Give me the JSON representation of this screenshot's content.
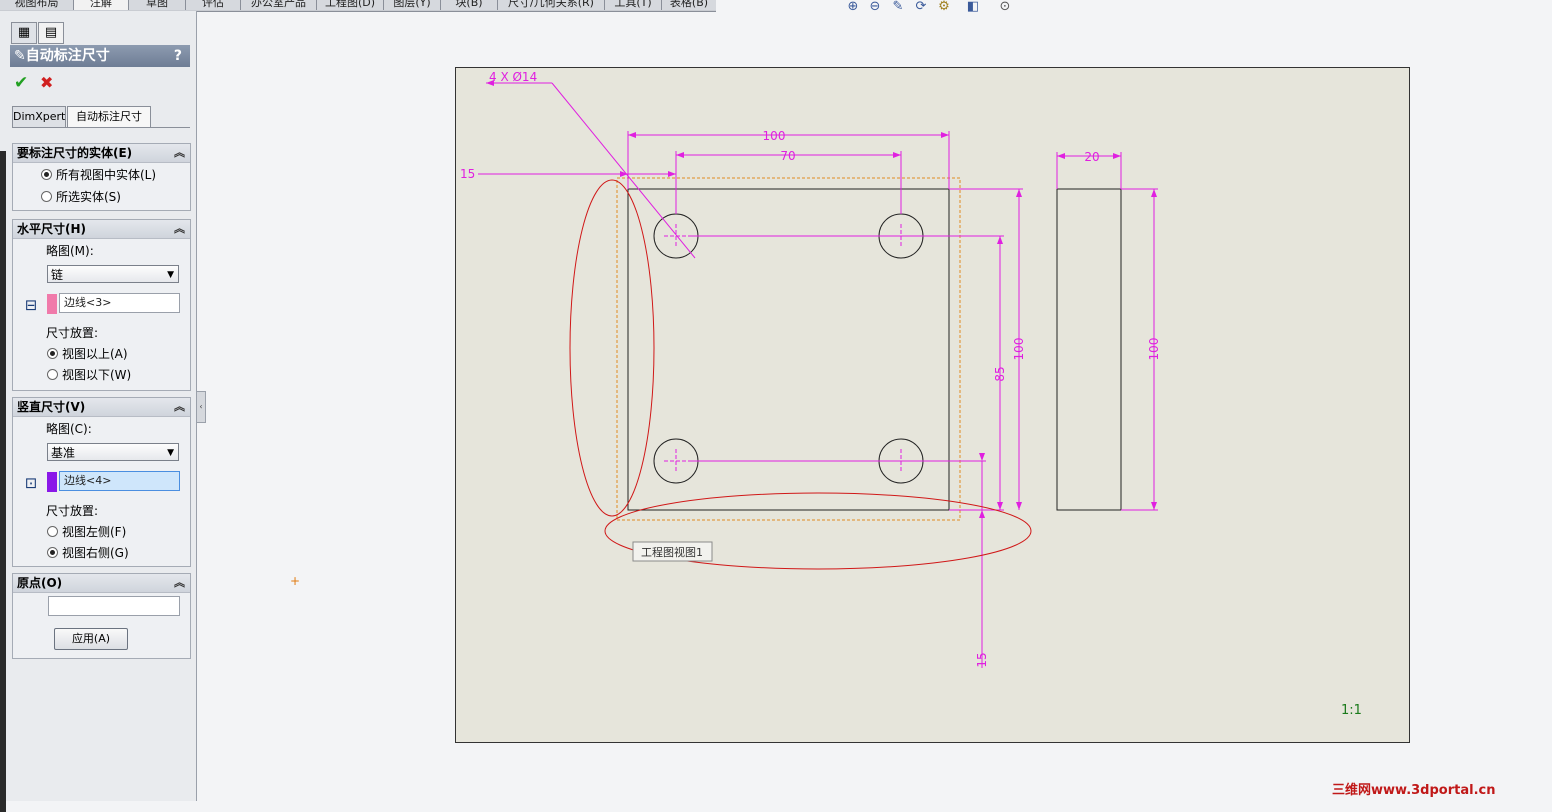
{
  "menu_tabs": [
    {
      "label": "视图布局",
      "active": false
    },
    {
      "label": "注解",
      "active": true
    },
    {
      "label": "草图",
      "active": false
    },
    {
      "label": "评估",
      "active": false
    },
    {
      "label": "办公室产品",
      "active": false
    },
    {
      "label": "工程图(D)",
      "active": false
    },
    {
      "label": "图层(Y)",
      "active": false
    },
    {
      "label": "块(B)",
      "active": false
    },
    {
      "label": "尺寸/几何关系(R)",
      "active": false
    },
    {
      "label": "工具(T)",
      "active": false
    },
    {
      "label": "表格(B)",
      "active": false
    }
  ],
  "view_toolbar": {
    "icons": [
      "zoom-fit-icon",
      "zoom-area-icon",
      "pan-icon",
      "rotate-icon",
      "settings-icon",
      "display-style-icon",
      "view-options-icon"
    ],
    "glyphs": [
      "⊕",
      "⊖",
      "✎",
      "⟳",
      "⚙",
      "◧",
      "⊙"
    ]
  },
  "panel": {
    "title": "自动标注尺寸",
    "help": "?",
    "ok_glyph": "✔",
    "cancel_glyph": "✖",
    "subtabs": [
      {
        "label": "DimXpert",
        "active": false
      },
      {
        "label": "自动标注尺寸",
        "active": true
      }
    ],
    "entities": {
      "header": "要标注尺寸的实体(E)",
      "options": [
        {
          "label": "所有视图中实体(L)",
          "checked": true
        },
        {
          "label": "所选实体(S)",
          "checked": false
        }
      ]
    },
    "horizontal": {
      "header": "水平尺寸(H)",
      "scheme_label": "略图(M):",
      "scheme_value": "链",
      "edge_value": "边线<3>",
      "edge_color": "#f07aaa",
      "placement_label": "尺寸放置:",
      "options": [
        {
          "label": "视图以上(A)",
          "checked": true
        },
        {
          "label": "视图以下(W)",
          "checked": false
        }
      ]
    },
    "vertical": {
      "header": "竖直尺寸(V)",
      "scheme_label": "略图(C):",
      "scheme_value": "基准",
      "edge_value": "边线<4>",
      "edge_color": "#8a18e8",
      "placement_label": "尺寸放置:",
      "options": [
        {
          "label": "视图左侧(F)",
          "checked": false
        },
        {
          "label": "视图右侧(G)",
          "checked": true
        }
      ]
    },
    "origin": {
      "header": "原点(O)",
      "value": "",
      "apply_label": "应用(A)"
    }
  },
  "drawing": {
    "dimension_color": "#e020e0",
    "annotation_color": "#d01818",
    "hole_callout": "4 X Ø14",
    "dims": {
      "top_100": "100",
      "top_70": "70",
      "left_15": "15",
      "right_85": "85",
      "right_100": "100",
      "bottom_15": "15",
      "side_20": "20",
      "side_100": "100"
    },
    "view_label": "工程图视图1",
    "scale": "1:1"
  },
  "watermark": "三维网www.3dportal.cn"
}
